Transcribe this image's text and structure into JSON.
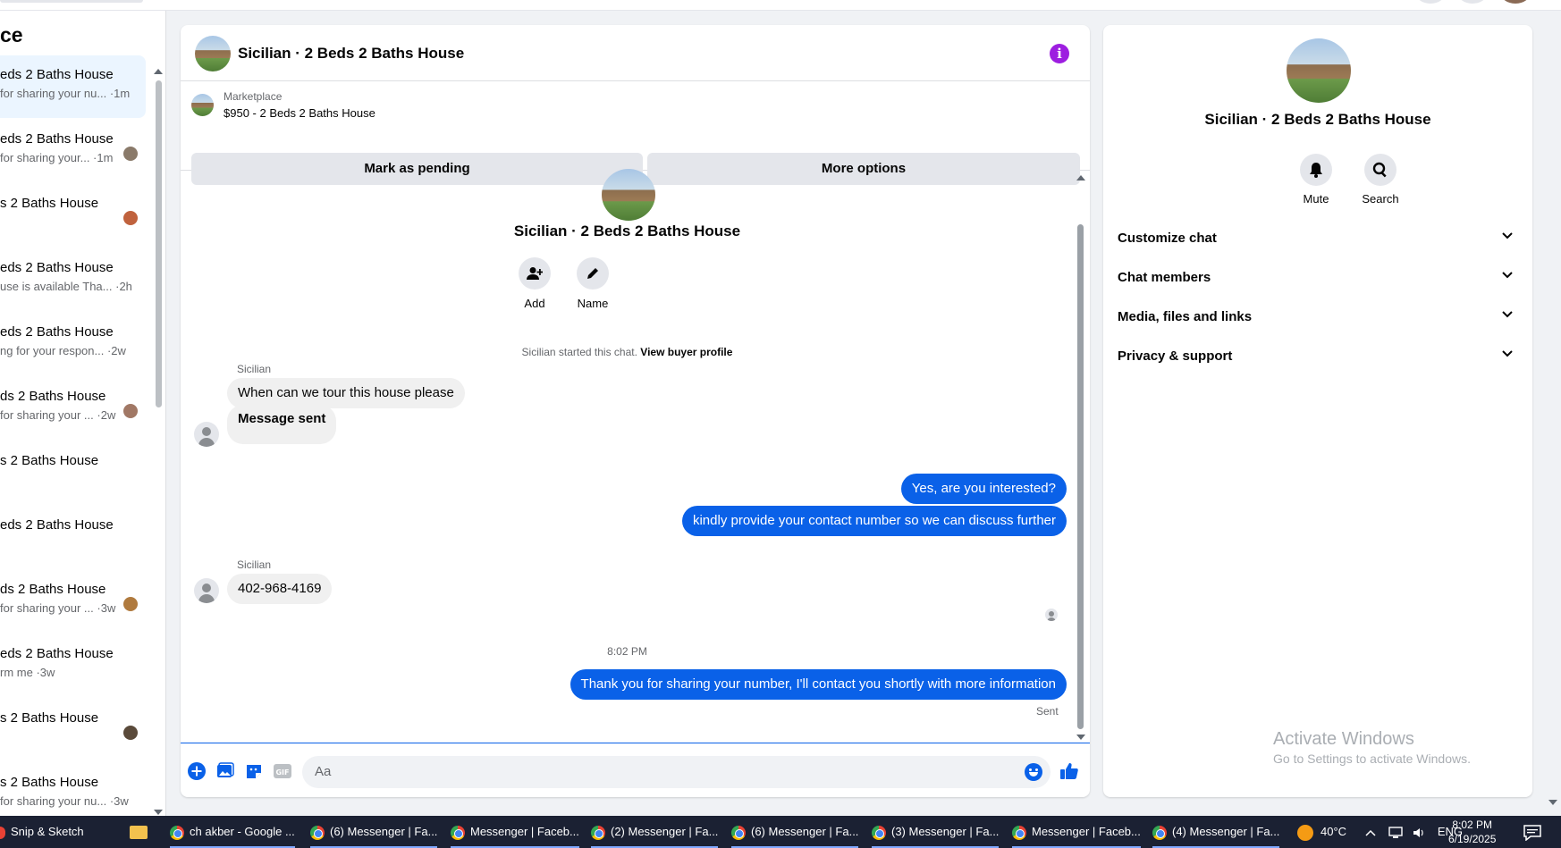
{
  "sidebar": {
    "title": "ce",
    "conversations": [
      {
        "name": "eds 2 Baths House",
        "preview": "for sharing your nu... ·1m",
        "active": true,
        "avatar": ""
      },
      {
        "name": "eds 2 Baths House",
        "preview": "for sharing your... ·1m",
        "active": false,
        "avatar": "#8a7a6a"
      },
      {
        "name": "s 2 Baths House",
        "preview": "",
        "active": false,
        "avatar": "#c0623d"
      },
      {
        "name": "eds 2 Baths House",
        "preview": "use is available Tha...  ·2h",
        "active": false,
        "avatar": ""
      },
      {
        "name": "eds 2 Baths House",
        "preview": "ng for your respon... ·2w",
        "active": false,
        "avatar": ""
      },
      {
        "name": "ds 2 Baths House",
        "preview": "for sharing your ... ·2w",
        "active": false,
        "avatar": "#a17865"
      },
      {
        "name": "s 2 Baths House",
        "preview": "",
        "active": false,
        "avatar": ""
      },
      {
        "name": "eds 2 Baths House",
        "preview": "",
        "active": false,
        "avatar": ""
      },
      {
        "name": "ds 2 Baths House",
        "preview": "for sharing your ... ·3w",
        "active": false,
        "avatar": "#b07a3e"
      },
      {
        "name": "eds 2 Baths House",
        "preview": "rm me ·3w",
        "active": false,
        "avatar": ""
      },
      {
        "name": "s 2 Baths House",
        "preview": "",
        "active": false,
        "avatar": "#5a4a3a"
      },
      {
        "name": "s 2 Baths House",
        "preview": "for sharing your nu... ·3w",
        "active": false,
        "avatar": ""
      }
    ]
  },
  "chat": {
    "title": "Sicilian · 2 Beds 2 Baths House",
    "info_icon": "info-icon",
    "listing": {
      "label": "Marketplace",
      "price": "$950 - 2 Beds 2 Baths House",
      "mark_pending": "Mark as pending",
      "more_options": "More options"
    },
    "intro": {
      "name": "Sicilian · 2 Beds 2 Baths House",
      "add_label": "Add",
      "name_label": "Name",
      "started_text": "Sicilian started this chat. ",
      "view_profile": "View buyer profile"
    },
    "messages": {
      "sender1": "Sicilian",
      "in1": "When can we tour this house please",
      "in2": "Message sent",
      "out1": "Yes, are you interested?",
      "out2": "kindly provide your contact number so we can discuss further",
      "sender2": "Sicilian",
      "in3": "402-968-4169",
      "time": "8:02 PM",
      "out3": "Thank you for sharing your number, I'll contact you shortly with more information",
      "status": "Sent"
    },
    "composer": {
      "placeholder": "Aa"
    }
  },
  "right_panel": {
    "title": "Sicilian · 2 Beds 2 Baths House",
    "mute_label": "Mute",
    "search_label": "Search",
    "sections": [
      "Customize chat",
      "Chat members",
      "Media, files and links",
      "Privacy & support"
    ],
    "watermark_title": "Activate Windows",
    "watermark_sub": "Go to Settings to activate Windows."
  },
  "taskbar": {
    "snip": "Snip & Sketch",
    "tabs": [
      "ch akber - Google ...",
      "(6) Messenger | Fa...",
      "Messenger | Faceb...",
      "(2) Messenger | Fa...",
      "(6) Messenger | Fa...",
      "(3) Messenger | Fa...",
      "Messenger | Faceb...",
      "(4) Messenger | Fa..."
    ],
    "temperature": "40°C",
    "language": "ENG",
    "time": "8:02 PM",
    "date": "6/19/2025"
  },
  "colors": {
    "accent": "#0a61e8",
    "info": "#9d1ee0",
    "taskbar": "#1b2133"
  }
}
